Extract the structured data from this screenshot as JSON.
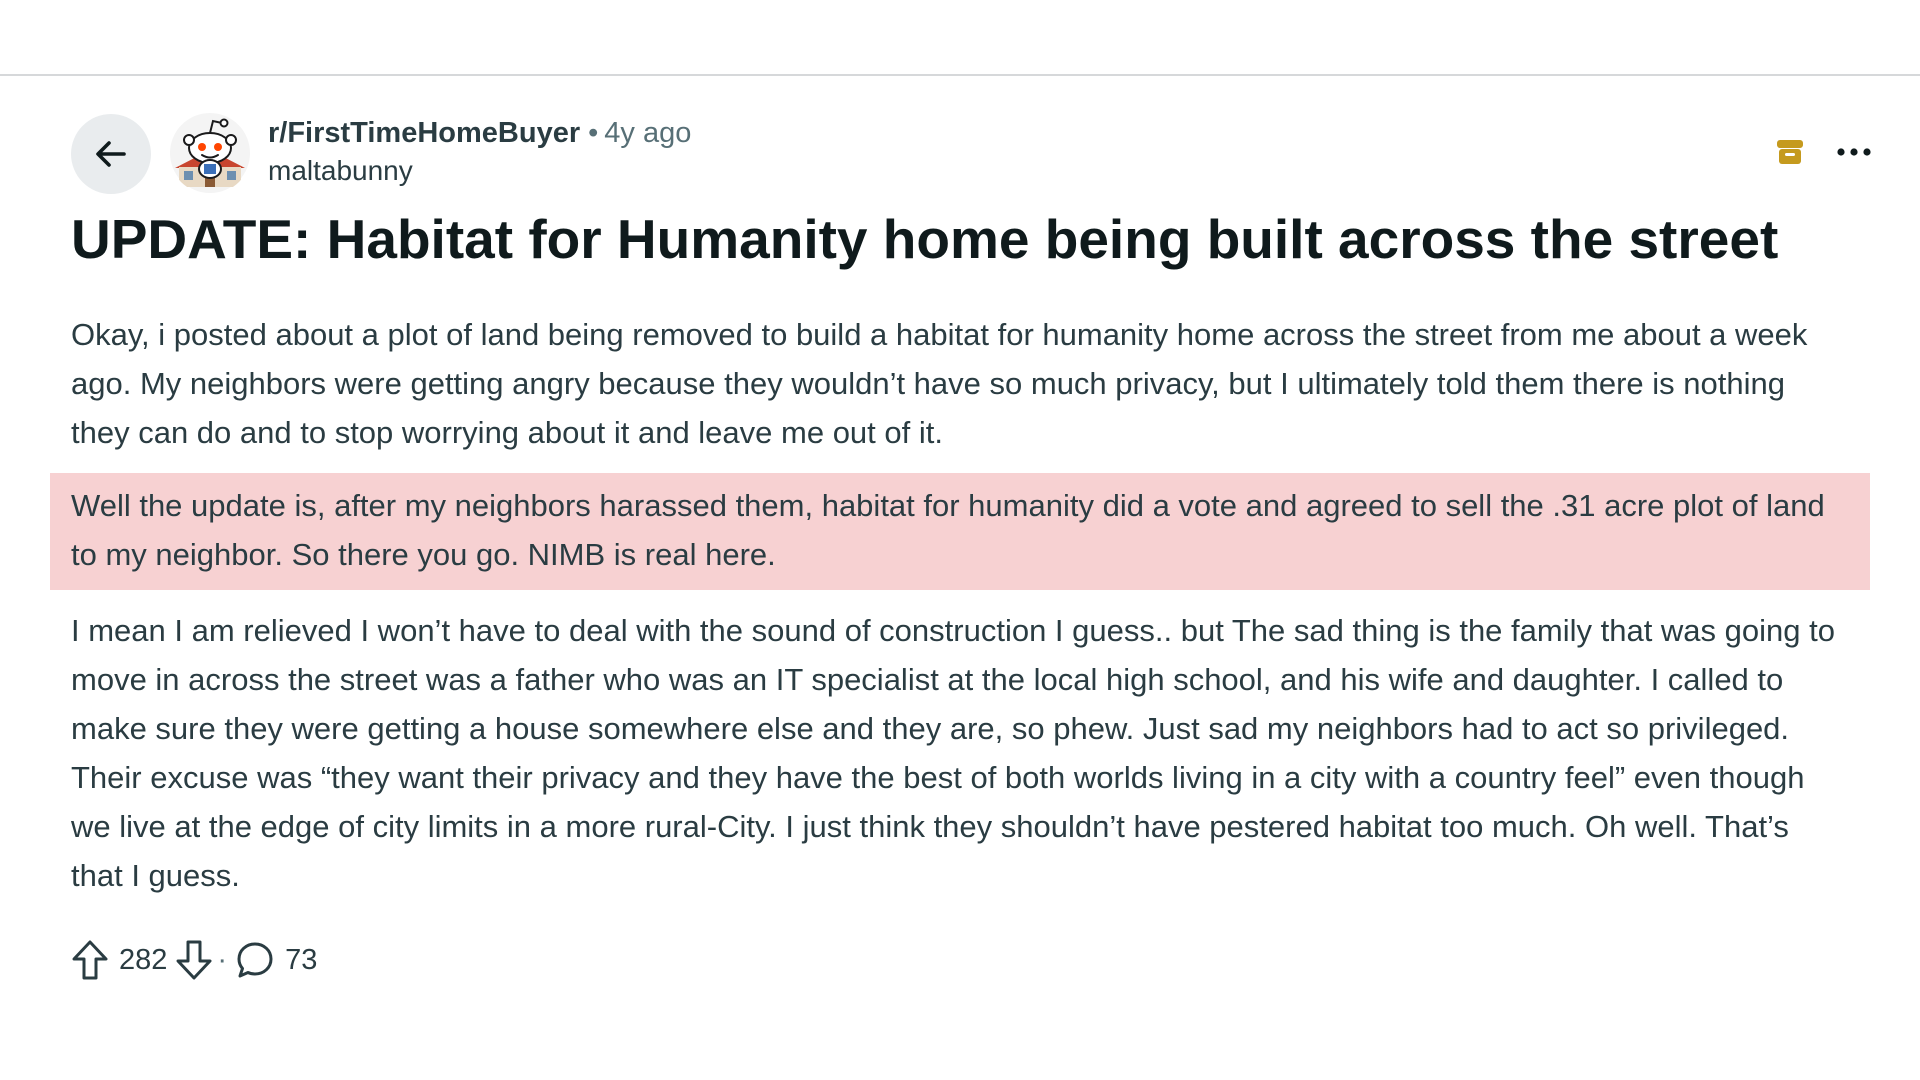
{
  "post": {
    "subreddit": "r/FirstTimeHomeBuyer",
    "separator": "•",
    "time_ago": "4y ago",
    "author": "maltabunny",
    "title": "UPDATE: Habitat for Humanity home being built across the street",
    "paragraphs": [
      "Okay, i posted about a plot of land being removed to build a habitat for humanity home across the street from me about a week ago. My neighbors were getting angry because they wouldn’t have so much privacy, but I ultimately told them there is nothing they can do and to stop worrying about it and leave me out of it.",
      "Well the update is, after my neighbors harassed them, habitat for humanity did a vote and agreed to sell the .31 acre plot of land to my neighbor. So there you go. NIMB is real here.",
      "I mean I am relieved I won’t have to deal with the sound of construction I guess.. but The sad thing is the family that was going to move in across the street was a father who was an IT specialist at the local high school, and his wife and daughter. I called to make sure they were getting a house somewhere else and they are, so phew. Just sad my neighbors had to act so privileged. Their excuse was “they want their privacy and they have the best of both worlds living in a city with a country feel” even though we live at the edge of city limits in a more rural-City. I just think they shouldn’t have pestered habitat too much. Oh well. That’s that I guess."
    ],
    "highlight_color": "#f7d1d2",
    "upvotes": "282",
    "footer_separator": "·",
    "comments": "73"
  },
  "icons": {
    "back": "arrow-left-icon",
    "archive": "archive-icon",
    "archive_color": "#c59a1e",
    "more": "more-horizontal-icon",
    "upvote": "arrow-up-outline-icon",
    "downvote": "arrow-down-outline-icon",
    "comment": "speech-bubble-icon"
  }
}
